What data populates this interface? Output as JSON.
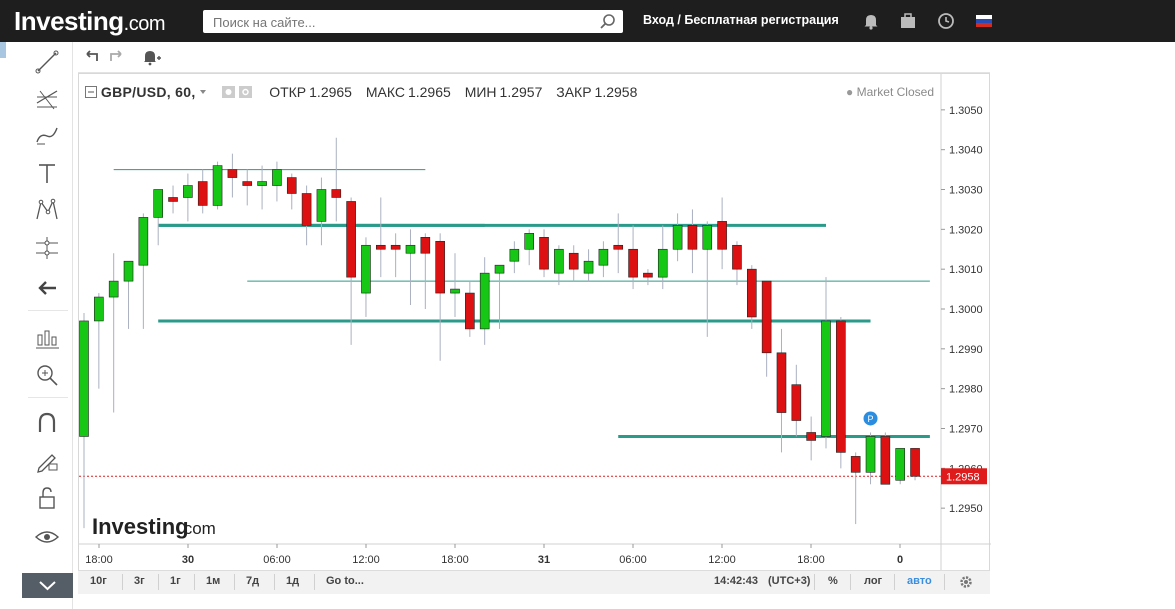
{
  "header": {
    "logo_text": "Investing",
    "logo_suffix": ".com",
    "search_placeholder": "Поиск на сайте...",
    "login_label": "Вход",
    "auth_separator": "/",
    "register_label": "Бесплатная регистрация",
    "icons": [
      "bell-icon",
      "briefcase-icon",
      "clock-icon",
      "russia-flag-icon"
    ]
  },
  "left_toolbar": {
    "tools": [
      "trendline-icon",
      "fib-icon",
      "brush-icon",
      "text-icon",
      "pattern-icon",
      "measure-icon",
      "back-arrow-icon",
      "indicators-icon",
      "zoom-icon",
      "magnet-icon",
      "lock-drawing-icon",
      "unlock-icon",
      "eye-icon"
    ]
  },
  "top_toolbar": {
    "icons": [
      "undo-icon",
      "redo-icon",
      "add-alert-icon"
    ]
  },
  "legend": {
    "symbol": "GBP/USD, 60,",
    "open_label": "ОТКР",
    "open": "1.2965",
    "high_label": "МАКС",
    "high": "1.2965",
    "low_label": "МИН",
    "low": "1.2957",
    "close_label": "ЗАКР",
    "close": "1.2958",
    "status": "Market Closed"
  },
  "watermark": {
    "text": "Investing",
    "suffix": ".com"
  },
  "bottom_bar": {
    "ranges": [
      "10г",
      "3г",
      "1г",
      "1м",
      "7д",
      "1д"
    ],
    "goto": "Go to...",
    "time": "14:42:43",
    "timezone": "(UTC+3)",
    "percent": "%",
    "log": "лог",
    "auto": "авто"
  },
  "colors": {
    "up": "#16c716",
    "down": "#dd1111",
    "hline": "#2a9a8a",
    "last_price": "#e01b1b",
    "auto": "#3a8ee0"
  },
  "chart_data": {
    "type": "candlestick",
    "symbol": "GBP/USD",
    "interval": "60",
    "y_ticks": [
      "1.2950",
      "1.2960",
      "1.2970",
      "1.2980",
      "1.2990",
      "1.3000",
      "1.3010",
      "1.3020",
      "1.3030",
      "1.3040",
      "1.3050"
    ],
    "ylim": [
      1.2941,
      1.3059
    ],
    "x_ticks": [
      "18:00",
      "30",
      "06:00",
      "12:00",
      "18:00",
      "31",
      "06:00",
      "12:00",
      "18:00",
      "0"
    ],
    "last_price": 1.2958,
    "last_price_label": "1.2958",
    "marker_label": "P",
    "candles": [
      {
        "o": 1.2968,
        "h": 1.2999,
        "l": 1.2945,
        "c": 1.2997
      },
      {
        "o": 1.2997,
        "h": 1.3004,
        "l": 1.298,
        "c": 1.3003
      },
      {
        "o": 1.3003,
        "h": 1.3014,
        "l": 1.2974,
        "c": 1.3007
      },
      {
        "o": 1.3007,
        "h": 1.3011,
        "l": 1.2995,
        "c": 1.3012
      },
      {
        "o": 1.3011,
        "h": 1.3024,
        "l": 1.2995,
        "c": 1.3023
      },
      {
        "o": 1.3023,
        "h": 1.303,
        "l": 1.3016,
        "c": 1.303
      },
      {
        "o": 1.3028,
        "h": 1.3031,
        "l": 1.3024,
        "c": 1.3027
      },
      {
        "o": 1.3028,
        "h": 1.3034,
        "l": 1.3022,
        "c": 1.3031
      },
      {
        "o": 1.3032,
        "h": 1.3035,
        "l": 1.3024,
        "c": 1.3026
      },
      {
        "o": 1.3026,
        "h": 1.3037,
        "l": 1.3025,
        "c": 1.3036
      },
      {
        "o": 1.3035,
        "h": 1.3039,
        "l": 1.3028,
        "c": 1.3033
      },
      {
        "o": 1.3032,
        "h": 1.3035,
        "l": 1.3026,
        "c": 1.3031
      },
      {
        "o": 1.3031,
        "h": 1.3036,
        "l": 1.3025,
        "c": 1.3032
      },
      {
        "o": 1.3031,
        "h": 1.3037,
        "l": 1.3027,
        "c": 1.3035
      },
      {
        "o": 1.3033,
        "h": 1.3034,
        "l": 1.3025,
        "c": 1.3029
      },
      {
        "o": 1.3029,
        "h": 1.3031,
        "l": 1.3016,
        "c": 1.3021
      },
      {
        "o": 1.3022,
        "h": 1.3033,
        "l": 1.3016,
        "c": 1.303
      },
      {
        "o": 1.303,
        "h": 1.3043,
        "l": 1.3022,
        "c": 1.3028
      },
      {
        "o": 1.3027,
        "h": 1.3028,
        "l": 1.2991,
        "c": 1.3008
      },
      {
        "o": 1.3004,
        "h": 1.3018,
        "l": 1.2998,
        "c": 1.3016
      },
      {
        "o": 1.3016,
        "h": 1.3028,
        "l": 1.3008,
        "c": 1.3015
      },
      {
        "o": 1.3016,
        "h": 1.3019,
        "l": 1.3008,
        "c": 1.3015
      },
      {
        "o": 1.3014,
        "h": 1.302,
        "l": 1.3001,
        "c": 1.3016
      },
      {
        "o": 1.3018,
        "h": 1.3019,
        "l": 1.3,
        "c": 1.3014
      },
      {
        "o": 1.3017,
        "h": 1.3019,
        "l": 1.2987,
        "c": 1.3004
      },
      {
        "o": 1.3004,
        "h": 1.3014,
        "l": 1.2998,
        "c": 1.3005
      },
      {
        "o": 1.3004,
        "h": 1.3007,
        "l": 1.2993,
        "c": 1.2995
      },
      {
        "o": 1.2995,
        "h": 1.3013,
        "l": 1.2991,
        "c": 1.3009
      },
      {
        "o": 1.3009,
        "h": 1.3011,
        "l": 1.2995,
        "c": 1.3011
      },
      {
        "o": 1.3012,
        "h": 1.3017,
        "l": 1.3009,
        "c": 1.3015
      },
      {
        "o": 1.3015,
        "h": 1.302,
        "l": 1.3011,
        "c": 1.3019
      },
      {
        "o": 1.3018,
        "h": 1.302,
        "l": 1.3008,
        "c": 1.301
      },
      {
        "o": 1.3009,
        "h": 1.3016,
        "l": 1.3006,
        "c": 1.3015
      },
      {
        "o": 1.3014,
        "h": 1.3016,
        "l": 1.3007,
        "c": 1.301
      },
      {
        "o": 1.3009,
        "h": 1.3015,
        "l": 1.3007,
        "c": 1.3012
      },
      {
        "o": 1.3011,
        "h": 1.3017,
        "l": 1.3008,
        "c": 1.3015
      },
      {
        "o": 1.3016,
        "h": 1.3024,
        "l": 1.3009,
        "c": 1.3015
      },
      {
        "o": 1.3015,
        "h": 1.3021,
        "l": 1.3005,
        "c": 1.3008
      },
      {
        "o": 1.3009,
        "h": 1.301,
        "l": 1.3006,
        "c": 1.3008
      },
      {
        "o": 1.3008,
        "h": 1.3021,
        "l": 1.3005,
        "c": 1.3015
      },
      {
        "o": 1.3015,
        "h": 1.3024,
        "l": 1.3012,
        "c": 1.3021
      },
      {
        "o": 1.3021,
        "h": 1.3025,
        "l": 1.3009,
        "c": 1.3015
      },
      {
        "o": 1.3015,
        "h": 1.3022,
        "l": 1.2993,
        "c": 1.3021
      },
      {
        "o": 1.3022,
        "h": 1.3028,
        "l": 1.301,
        "c": 1.3015
      },
      {
        "o": 1.3016,
        "h": 1.3017,
        "l": 1.3006,
        "c": 1.301
      },
      {
        "o": 1.301,
        "h": 1.3011,
        "l": 1.2995,
        "c": 1.2998
      },
      {
        "o": 1.3007,
        "h": 1.3007,
        "l": 1.2983,
        "c": 1.2989
      },
      {
        "o": 1.2989,
        "h": 1.2995,
        "l": 1.2964,
        "c": 1.2974
      },
      {
        "o": 1.2981,
        "h": 1.2986,
        "l": 1.2968,
        "c": 1.2972
      },
      {
        "o": 1.2969,
        "h": 1.2973,
        "l": 1.2962,
        "c": 1.2967
      },
      {
        "o": 1.2968,
        "h": 1.3008,
        "l": 1.2965,
        "c": 1.2997
      },
      {
        "o": 1.2997,
        "h": 1.2998,
        "l": 1.296,
        "c": 1.2964
      },
      {
        "o": 1.2963,
        "h": 1.2964,
        "l": 1.2946,
        "c": 1.2959
      },
      {
        "o": 1.2959,
        "h": 1.2969,
        "l": 1.2956,
        "c": 1.2968
      },
      {
        "o": 1.2968,
        "h": 1.2969,
        "l": 1.2956,
        "c": 1.2956
      },
      {
        "o": 1.2957,
        "h": 1.2965,
        "l": 1.2956,
        "c": 1.2965
      },
      {
        "o": 1.2965,
        "h": 1.2965,
        "l": 1.2957,
        "c": 1.2958
      }
    ],
    "horizontal_lines": [
      {
        "y": 1.3035,
        "from": 2,
        "to": 23,
        "weight": "thin"
      },
      {
        "y": 1.3021,
        "from": 5,
        "to": 50,
        "weight": "thick"
      },
      {
        "y": 1.3021,
        "from": 5,
        "to": 27,
        "weight": "thick"
      },
      {
        "y": 1.3007,
        "from": 11,
        "to": 57,
        "weight": "thin"
      },
      {
        "y": 1.2997,
        "from": 5,
        "to": 53,
        "weight": "thick"
      },
      {
        "y": 1.2968,
        "from": 36,
        "to": 57,
        "weight": "thick"
      }
    ]
  }
}
